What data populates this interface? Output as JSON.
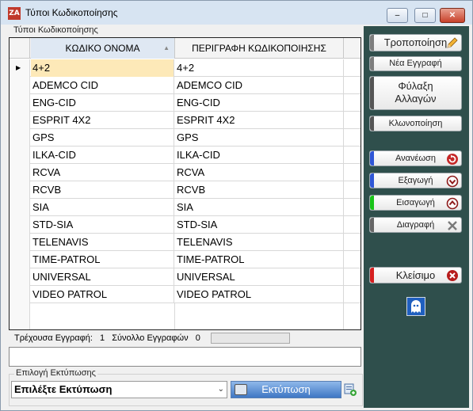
{
  "window": {
    "title": "Τύποι Κωδικοποίησης",
    "app_icon": "ZA",
    "minimize": "–",
    "maximize": "□",
    "close": "✕"
  },
  "group_label": "Τύποι Κωδικοποίησης",
  "grid": {
    "columns": [
      "ΚΩΔΙΚΟ ΟΝΟΜΑ",
      "ΠΕΡΙΓΡΑΦΗ ΚΩΔΙΚΟΠΟΙΗΣΗΣ"
    ],
    "rows": [
      [
        "4+2",
        "4+2"
      ],
      [
        "ADEMCO CID",
        "ADEMCO CID"
      ],
      [
        "ENG-CID",
        "ENG-CID"
      ],
      [
        "ESPRIT 4X2",
        "ESPRIT 4X2"
      ],
      [
        "GPS",
        "GPS"
      ],
      [
        "ILKA-CID",
        "ILKA-CID"
      ],
      [
        "RCVA",
        "RCVA"
      ],
      [
        "RCVB",
        "RCVB"
      ],
      [
        "SIA",
        "SIA"
      ],
      [
        "STD-SIA",
        "STD-SIA"
      ],
      [
        "TELENAVIS",
        "TELENAVIS"
      ],
      [
        "TIME-PATROL",
        "TIME-PATROL"
      ],
      [
        "UNIVERSAL",
        "UNIVERSAL"
      ],
      [
        "VIDEO PATROL",
        "VIDEO PATROL"
      ]
    ],
    "current_row_marker": "▶"
  },
  "status": {
    "current_label": "Τρέχουσα Εγγραφή:",
    "current_value": "1",
    "total_label": "Σύνολλο Εγγραφών",
    "total_value": "0"
  },
  "print": {
    "label": "Επιλογή Εκτύπωσης",
    "select_value": "Επιλέξτε Εκτύπωση",
    "button": "Εκτύπωση"
  },
  "sidebar": {
    "buttons": [
      {
        "label": "Τροποποίηση",
        "icon": "pencil-icon",
        "accent": "#7d7d7d"
      },
      {
        "label": "Νέα Εγγραφή",
        "icon": "",
        "accent": "#7d7d7d"
      },
      {
        "label": "Φύλαξη\nΑλλαγών",
        "icon": "",
        "accent": "#555555"
      },
      {
        "label": "Κλωνοποίηση",
        "icon": "",
        "accent": "#555555"
      },
      {
        "label": "Ανανέωση",
        "icon": "refresh-icon",
        "accent": "#2f56d6"
      },
      {
        "label": "Εξαγωγή",
        "icon": "export-icon",
        "accent": "#2f56d6"
      },
      {
        "label": "Εισαγωγή",
        "icon": "import-icon",
        "accent": "#19c419"
      },
      {
        "label": "Διαγραφή",
        "icon": "delete-icon",
        "accent": "#666666"
      },
      {
        "label": "Κλείσιμο",
        "icon": "close-icon",
        "accent": "#d61f1f"
      }
    ]
  },
  "colors": {
    "sidebar_bg": "#2f4f4c",
    "current_row": "#fde9b8",
    "print_button": "#3f77c4"
  }
}
